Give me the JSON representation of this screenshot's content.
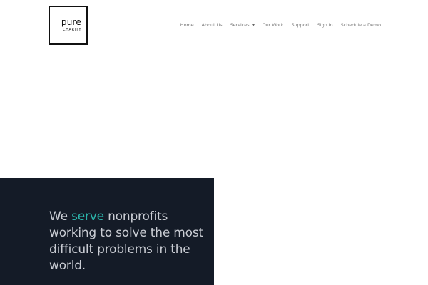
{
  "logo": {
    "word": "pure",
    "sub": "CHARITY"
  },
  "nav": {
    "items": [
      {
        "label": "Home"
      },
      {
        "label": "About Us"
      },
      {
        "label": "Services",
        "has_dropdown": true
      },
      {
        "label": "Our Work"
      },
      {
        "label": "Support"
      },
      {
        "label": "Sign In"
      },
      {
        "label": "Schedule a Demo"
      }
    ]
  },
  "hero": {
    "pre": "We ",
    "accent_word": "serve",
    "post": " nonprofits working to solve the most difficult problems in the world."
  },
  "colors": {
    "panel": "#141b27",
    "accent": "#2bb3a9",
    "hero_text": "#c9ccd3",
    "nav_text": "#7a7a7a"
  }
}
